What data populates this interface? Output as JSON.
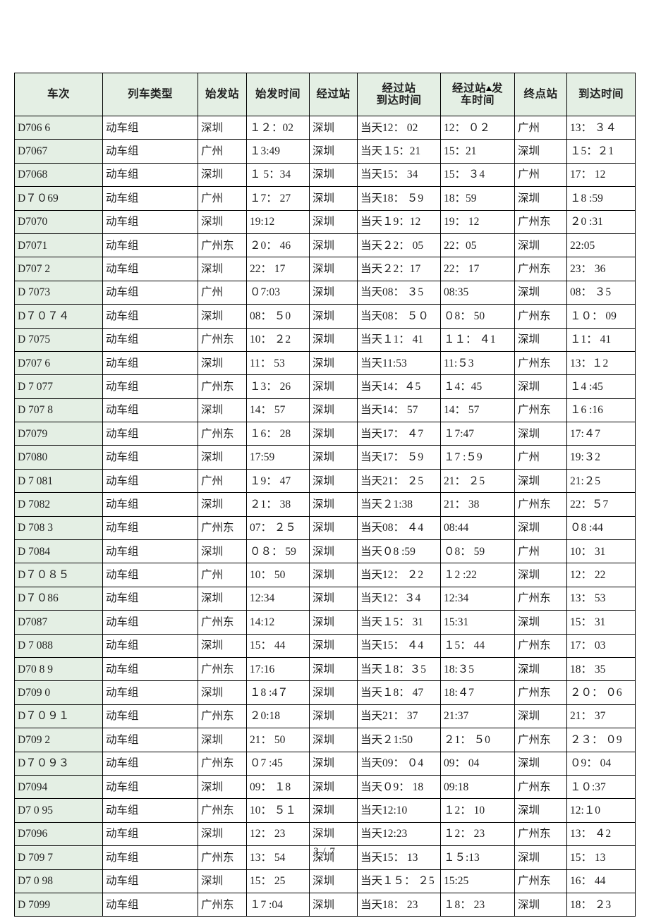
{
  "document": {
    "footer_page_label": "3 / 7"
  },
  "table": {
    "headers": [
      {
        "key": "train_no",
        "line1": "车次",
        "line2": ""
      },
      {
        "key": "train_type",
        "line1": "列车类型",
        "line2": ""
      },
      {
        "key": "origin_station",
        "line1": "始发站",
        "line2": ""
      },
      {
        "key": "departure_time",
        "line1": "始发时间",
        "line2": ""
      },
      {
        "key": "via_station",
        "line1": "经过站",
        "line2": ""
      },
      {
        "key": "via_arrival_time",
        "line1": "经过站",
        "line2": "到达时间"
      },
      {
        "key": "via_departure_time",
        "line1": "经过站",
        "line2": "车时间",
        "icon": "triangle-up-icon",
        "suffix1": "发"
      },
      {
        "key": "terminal_station",
        "line1": "终点站",
        "line2": ""
      },
      {
        "key": "arrival_time",
        "line1": "到达时间",
        "line2": ""
      }
    ],
    "rows": [
      {
        "train_no": "D706 6",
        "train_type": "动车组",
        "origin_station": "深圳",
        "departure_time": "１２：02",
        "via_station": "深圳",
        "via_arrival_time": "当天12： 02",
        "via_departure_time": "12： ０２",
        "terminal_station": "广州",
        "arrival_time": "13： ３４"
      },
      {
        "train_no": "D7067",
        "train_type": "动车组",
        "origin_station": "广州",
        "departure_time": "１3:49",
        "via_station": "深圳",
        "via_arrival_time": "当天１5：21",
        "via_departure_time": "15：21",
        "terminal_station": "深圳",
        "arrival_time": "１5：２1"
      },
      {
        "train_no": "D7068",
        "train_type": "动车组",
        "origin_station": "深圳",
        "departure_time": "１ 5：34",
        "via_station": "深圳",
        "via_arrival_time": "当天15： 34",
        "via_departure_time": "15： ３4",
        "terminal_station": "广州",
        "arrival_time": "17： 12"
      },
      {
        "train_no": "D７０69",
        "train_type": "动车组",
        "origin_station": "广州",
        "departure_time": "１7： 27",
        "via_station": "深圳",
        "via_arrival_time": "当天18： ５9",
        "via_departure_time": "18：59",
        "terminal_station": "深圳",
        "arrival_time": "１8 :59"
      },
      {
        "train_no": "D7070",
        "train_type": "动车组",
        "origin_station": "深圳",
        "departure_time": "19:12",
        "via_station": "深圳",
        "via_arrival_time": "当天１9：12",
        "via_departure_time": "19： 12",
        "terminal_station": "广州东",
        "arrival_time": "２0 :31"
      },
      {
        "train_no": "D7071",
        "train_type": "动车组",
        "origin_station": "广州东",
        "departure_time": "２0： 46",
        "via_station": "深圳",
        "via_arrival_time": "当天２2： 05",
        "via_departure_time": "22：05",
        "terminal_station": "深圳",
        "arrival_time": "22:05"
      },
      {
        "train_no": "D707 2",
        "train_type": "动车组",
        "origin_station": "深圳",
        "departure_time": "22： 17",
        "via_station": "深圳",
        "via_arrival_time": "当天２2：17",
        "via_departure_time": "22： 17",
        "terminal_station": "广州东",
        "arrival_time": "23： 36"
      },
      {
        "train_no": "D 7073",
        "train_type": "动车组",
        "origin_station": "广州",
        "departure_time": "０7:03",
        "via_station": "深圳",
        "via_arrival_time": "当天08： ３5",
        "via_departure_time": "08:35",
        "terminal_station": "深圳",
        "arrival_time": "08： ３5"
      },
      {
        "train_no": "D７０７４",
        "train_type": "动车组",
        "origin_station": "深圳",
        "departure_time": "08： ５0",
        "via_station": "深圳",
        "via_arrival_time": "当天08： ５０",
        "via_departure_time": "０8： 50",
        "terminal_station": "广州东",
        "arrival_time": "１０： 09"
      },
      {
        "train_no": "D 7075",
        "train_type": "动车组",
        "origin_station": "广州东",
        "departure_time": "10： ２2",
        "via_station": "深圳",
        "via_arrival_time": "当天１1： 41",
        "via_departure_time": "１１： ４1",
        "terminal_station": "深圳",
        "arrival_time": "１1： 41"
      },
      {
        "train_no": "D707 6",
        "train_type": "动车组",
        "origin_station": "深圳",
        "departure_time": "11： 53",
        "via_station": "深圳",
        "via_arrival_time": "当天11:53",
        "via_departure_time": "11:５3",
        "terminal_station": "广州东",
        "arrival_time": "13：１2"
      },
      {
        "train_no": "D 7 077",
        "train_type": "动车组",
        "origin_station": "广州东",
        "departure_time": "１3： 26",
        "via_station": "深圳",
        "via_arrival_time": "当天14：４5",
        "via_departure_time": "１4：45",
        "terminal_station": "深圳",
        "arrival_time": "１4 :45"
      },
      {
        "train_no": "D 707 8",
        "train_type": "动车组",
        "origin_station": "深圳",
        "departure_time": "14： 57",
        "via_station": "深圳",
        "via_arrival_time": "当天14： 57",
        "via_departure_time": "14： 57",
        "terminal_station": "广州东",
        "arrival_time": "１6 :16"
      },
      {
        "train_no": "D7079",
        "train_type": "动车组",
        "origin_station": "广州东",
        "departure_time": "１6： 28",
        "via_station": "深圳",
        "via_arrival_time": "当天17： ４7",
        "via_departure_time": "１7:47",
        "terminal_station": "深圳",
        "arrival_time": "17:４7"
      },
      {
        "train_no": "D7080",
        "train_type": "动车组",
        "origin_station": "深圳",
        "departure_time": "17:59",
        "via_station": "深圳",
        "via_arrival_time": "当天17： ５9",
        "via_departure_time": "１7 :５9",
        "terminal_station": "广州",
        "arrival_time": "19:３2"
      },
      {
        "train_no": "D 7 081",
        "train_type": "动车组",
        "origin_station": "广州",
        "departure_time": "１9： 47",
        "via_station": "深圳",
        "via_arrival_time": "当天21： ２5",
        "via_departure_time": "21： ２5",
        "terminal_station": "深圳",
        "arrival_time": "21:２5"
      },
      {
        "train_no": "D 7082",
        "train_type": "动车组",
        "origin_station": "深圳",
        "departure_time": "２1： 38",
        "via_station": "深圳",
        "via_arrival_time": "当天２1:38",
        "via_departure_time": "21： 38",
        "terminal_station": "广州东",
        "arrival_time": "22：５7"
      },
      {
        "train_no": "D 708 3",
        "train_type": "动车组",
        "origin_station": "广州东",
        "departure_time": "07： ２５",
        "via_station": "深圳",
        "via_arrival_time": "当天08： ４4",
        "via_departure_time": "08:44",
        "terminal_station": "深圳",
        "arrival_time": "０8 :44"
      },
      {
        "train_no": "D 7084",
        "train_type": "动车组",
        "origin_station": "深圳",
        "departure_time": "０８： 59",
        "via_station": "深圳",
        "via_arrival_time": "当天０8 :59",
        "via_departure_time": "０8： 59",
        "terminal_station": "广州",
        "arrival_time": "10： 31"
      },
      {
        "train_no": "D７０８５",
        "train_type": "动车组",
        "origin_station": "广州",
        "departure_time": "10： 50",
        "via_station": "深圳",
        "via_arrival_time": "当天12： ２2",
        "via_departure_time": "１2 :22",
        "terminal_station": "深圳",
        "arrival_time": "12： 22"
      },
      {
        "train_no": "D７０86",
        "train_type": "动车组",
        "origin_station": "深圳",
        "departure_time": "12:34",
        "via_station": "深圳",
        "via_arrival_time": "当天12：３4",
        "via_departure_time": "12:34",
        "terminal_station": "广州东",
        "arrival_time": "13： 53"
      },
      {
        "train_no": "D7087",
        "train_type": "动车组",
        "origin_station": "广州东",
        "departure_time": "14:12",
        "via_station": "深圳",
        "via_arrival_time": "当天１5： 31",
        "via_departure_time": "15:31",
        "terminal_station": "深圳",
        "arrival_time": "15： 31"
      },
      {
        "train_no": "D 7 088",
        "train_type": "动车组",
        "origin_station": "深圳",
        "departure_time": "15： 44",
        "via_station": "深圳",
        "via_arrival_time": "当天15： ４4",
        "via_departure_time": "１5： 44",
        "terminal_station": "广州东",
        "arrival_time": "17： 03"
      },
      {
        "train_no": "D70 8 9",
        "train_type": "动车组",
        "origin_station": "广州东",
        "departure_time": "17:16",
        "via_station": "深圳",
        "via_arrival_time": "当天１8：３5",
        "via_departure_time": "18:３5",
        "terminal_station": "深圳",
        "arrival_time": "18： 35"
      },
      {
        "train_no": "D709 0",
        "train_type": "动车组",
        "origin_station": "深圳",
        "departure_time": "１8 :4７",
        "via_station": "深圳",
        "via_arrival_time": "当天１8： 47",
        "via_departure_time": "18:４7",
        "terminal_station": "广州东",
        "arrival_time": "２０： ０6"
      },
      {
        "train_no": "D７０９１",
        "train_type": "动车组",
        "origin_station": "广州东",
        "departure_time": "２0:18",
        "via_station": "深圳",
        "via_arrival_time": "当天21： 37",
        "via_departure_time": "21:37",
        "terminal_station": "深圳",
        "arrival_time": "21： 37"
      },
      {
        "train_no": "D709 2",
        "train_type": "动车组",
        "origin_station": "深圳",
        "departure_time": "21： 50",
        "via_station": "深圳",
        "via_arrival_time": "当天２1:50",
        "via_departure_time": "２1： ５0",
        "terminal_station": "广州东",
        "arrival_time": "２３： ０9"
      },
      {
        "train_no": "D７０９３",
        "train_type": "动车组",
        "origin_station": "广州东",
        "departure_time": "０7 :45",
        "via_station": "深圳",
        "via_arrival_time": "当天09： ０4",
        "via_departure_time": "09： 04",
        "terminal_station": "深圳",
        "arrival_time": "０9： 04"
      },
      {
        "train_no": "D7094",
        "train_type": "动车组",
        "origin_station": "深圳",
        "departure_time": "09： １8",
        "via_station": "深圳",
        "via_arrival_time": "当天０9： 18",
        "via_departure_time": "09:18",
        "terminal_station": "广州东",
        "arrival_time": "１０:37"
      },
      {
        "train_no": "D7 0 95",
        "train_type": "动车组",
        "origin_station": "广州东",
        "departure_time": "10： ５１",
        "via_station": "深圳",
        "via_arrival_time": "当天12:10",
        "via_departure_time": "１2： 10",
        "terminal_station": "深圳",
        "arrival_time": "12:１0"
      },
      {
        "train_no": "D7096",
        "train_type": "动车组",
        "origin_station": "深圳",
        "departure_time": "12： 23",
        "via_station": "深圳",
        "via_arrival_time": "当天12:23",
        "via_departure_time": "１2： 23",
        "terminal_station": "广州东",
        "arrival_time": "13： ４2"
      },
      {
        "train_no": "D 709 7",
        "train_type": "动车组",
        "origin_station": "广州东",
        "departure_time": "13： 54",
        "via_station": "深圳",
        "via_arrival_time": "当天15： 13",
        "via_departure_time": "１５:13",
        "terminal_station": "深圳",
        "arrival_time": "15： 13"
      },
      {
        "train_no": "D7 0 98",
        "train_type": "动车组",
        "origin_station": "深圳",
        "departure_time": "15： 25",
        "via_station": "深圳",
        "via_arrival_time": "当天１５： ２5",
        "via_departure_time": "15:25",
        "terminal_station": "广州东",
        "arrival_time": "16： 44"
      },
      {
        "train_no": "D 7099",
        "train_type": "动车组",
        "origin_station": "广州东",
        "departure_time": "１7 :04",
        "via_station": "深圳",
        "via_arrival_time": "当天18： 23",
        "via_departure_time": "１8： 23",
        "terminal_station": "深圳",
        "arrival_time": "18： ２3"
      }
    ]
  }
}
